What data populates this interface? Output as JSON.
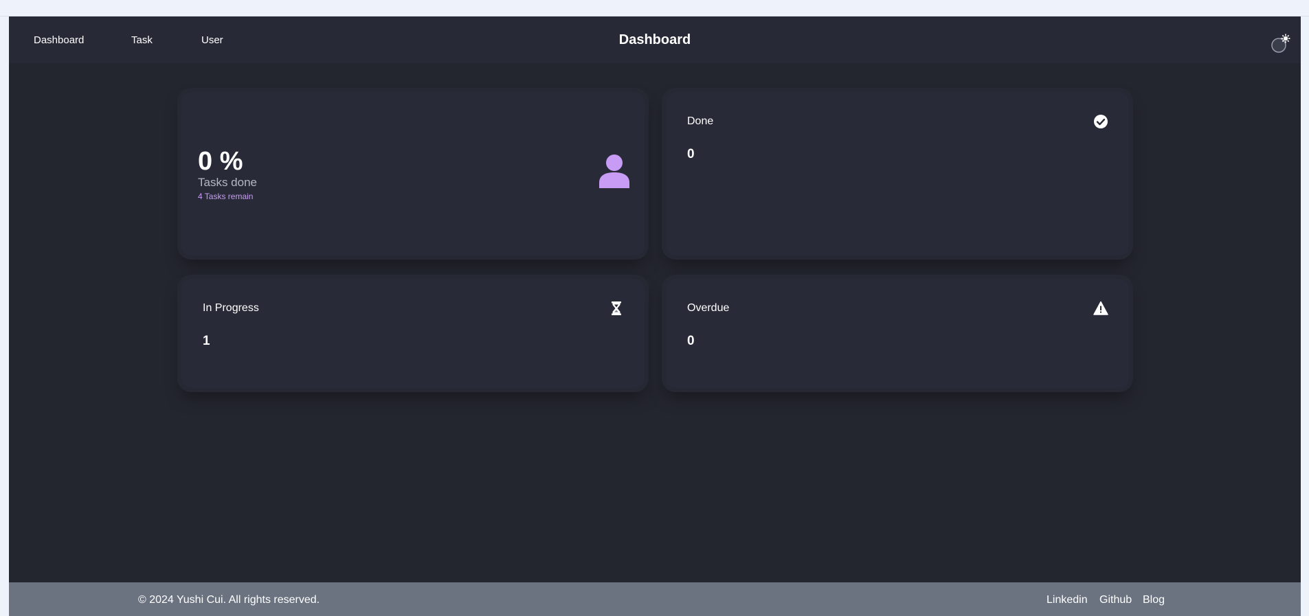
{
  "nav": {
    "links": [
      "Dashboard",
      "Task",
      "User"
    ],
    "title": "Dashboard",
    "theme_toggle_icon": "sun-moon-icon"
  },
  "summary_card": {
    "percent": "0 %",
    "label": "Tasks done",
    "remain": "4 Tasks remain",
    "icon": "user-icon",
    "icon_color": "#c89cf5"
  },
  "stats": {
    "done": {
      "title": "Done",
      "value": "0",
      "icon": "check-circle-icon"
    },
    "in_progress": {
      "title": "In Progress",
      "value": "1",
      "icon": "hourglass-icon"
    },
    "overdue": {
      "title": "Overdue",
      "value": "0",
      "icon": "warning-icon"
    }
  },
  "footer": {
    "copyright": "© 2024 Yushi Cui. All rights reserved.",
    "links": [
      "Linkedin",
      "Github",
      "Blog"
    ]
  },
  "colors": {
    "background": "#24262f",
    "navbar": "#272936",
    "card": "#282a38",
    "footer": "#6b7280",
    "accent": "#c89cf5"
  }
}
